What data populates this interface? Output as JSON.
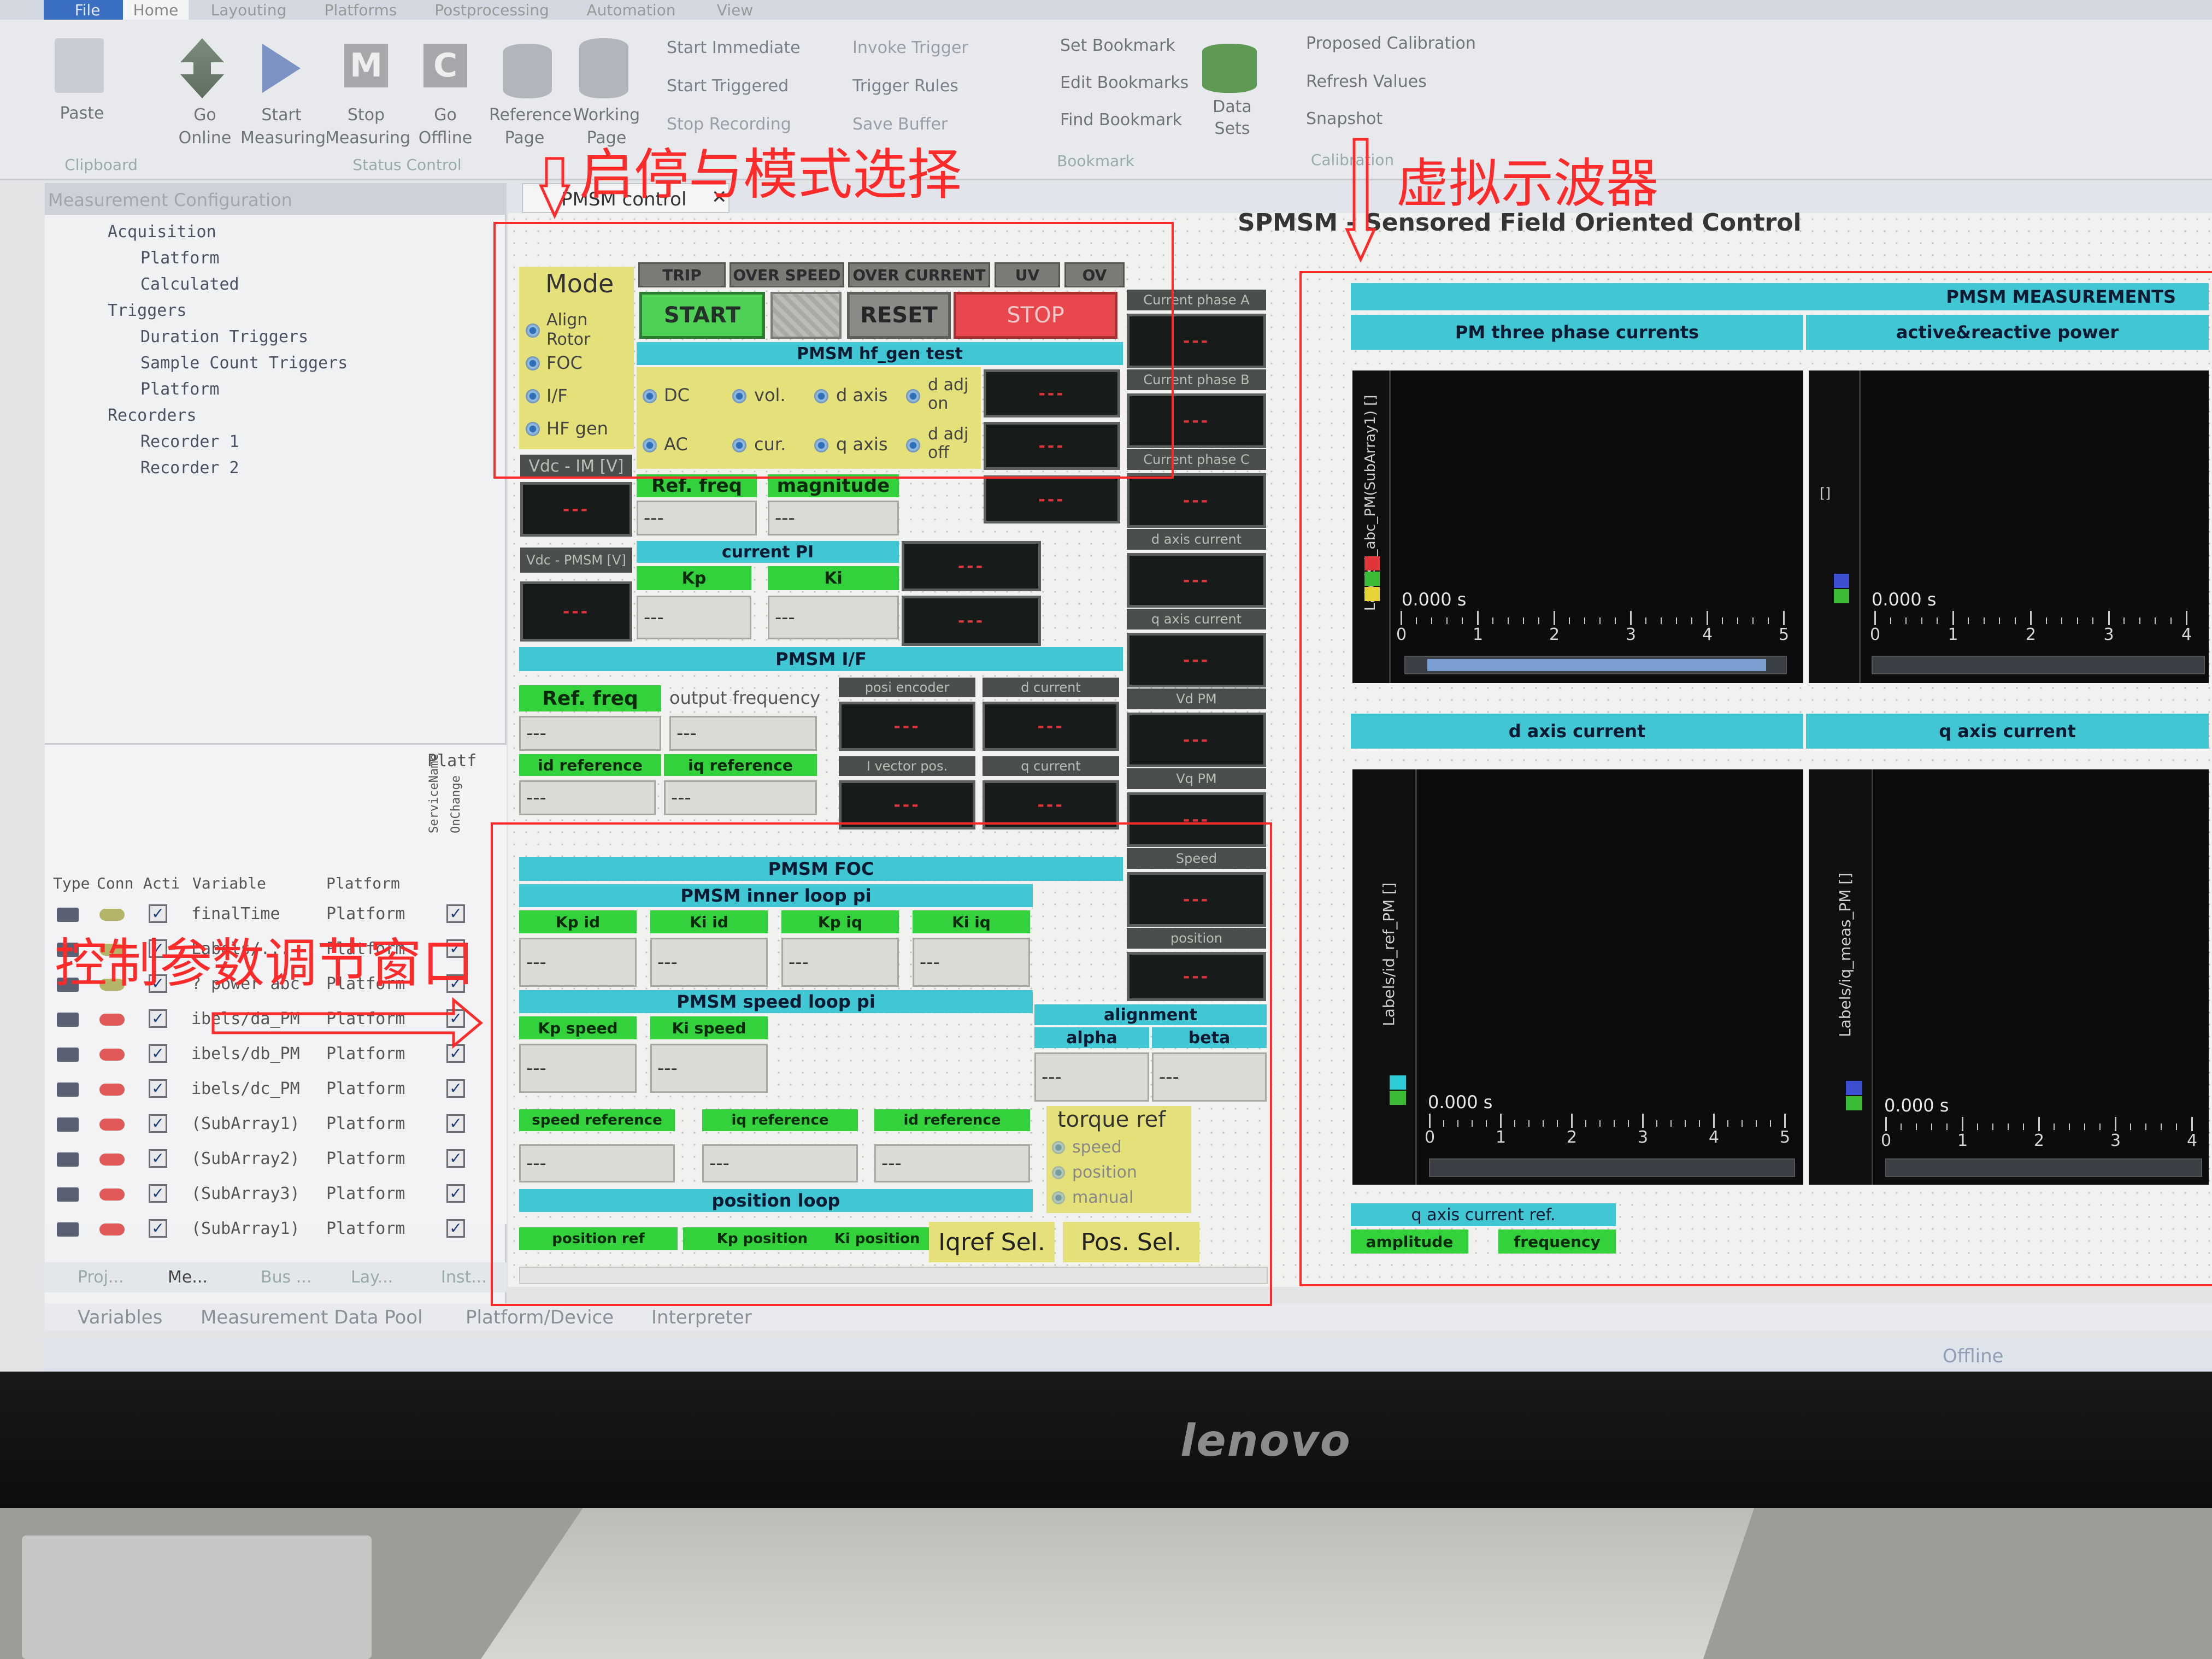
{
  "ribbon": {
    "tabs": [
      "File",
      "Home",
      "Layouting",
      "Platforms",
      "Postprocessing",
      "Automation",
      "View"
    ],
    "clipboard": {
      "paste": "Paste",
      "group": "Clipboard"
    },
    "status_control": {
      "go_online": "Go Online",
      "start_measuring": "Start Measuring",
      "stop_measuring": "Stop Measuring",
      "go_offline": "Go Offline",
      "reference_page": "Reference Page",
      "working_page": "Working Page",
      "group": "Status Control"
    },
    "recording": {
      "start_immediate": "Start Immediate",
      "invoke_trigger": "Invoke Trigger",
      "start_triggered": "Start Triggered",
      "trigger_rules": "Trigger Rules",
      "stop_recording": "Stop Recording",
      "save_buffer": "Save Buffer"
    },
    "bookmark": {
      "set": "Set Bookmark",
      "edit": "Edit Bookmarks",
      "find": "Find Bookmark",
      "group": "Bookmark"
    },
    "data_sets": "Data Sets",
    "calibration": {
      "proposed": "Proposed Calibration",
      "refresh": "Refresh Values",
      "snapshot": "Snapshot",
      "group": "Calibration"
    }
  },
  "left_panel": {
    "title": "Measurement Configuration",
    "tree": [
      "Acquisition",
      "Platform",
      "Calculated",
      "Triggers",
      "Duration Triggers",
      "Sample Count Triggers",
      "Platform",
      "Recorders",
      "Recorder 1",
      "Recorder 2"
    ],
    "grid_header": {
      "type": "Type",
      "conn": "Conn",
      "act": "Acti",
      "variable": "Variable",
      "platform": "Platform",
      "plat_col": "Platf",
      "service": "ServiceName",
      "onchange": "OnChange"
    },
    "rows": [
      {
        "variable": "finalTime",
        "platform": "Platform"
      },
      {
        "variable": "Labels/...",
        "platform": "Platform"
      },
      {
        "variable": "? power abc",
        "platform": "Platform"
      },
      {
        "variable": "ibels/da_PM",
        "platform": "Platform"
      },
      {
        "variable": "ibels/db_PM",
        "platform": "Platform"
      },
      {
        "variable": "ibels/dc_PM",
        "platform": "Platform"
      },
      {
        "variable": "(SubArray1)",
        "platform": "Platform"
      },
      {
        "variable": "(SubArray2)",
        "platform": "Platform"
      },
      {
        "variable": "(SubArray3)",
        "platform": "Platform"
      },
      {
        "variable": "(SubArray1)",
        "platform": "Platform"
      }
    ],
    "bottom_tabs": [
      "Proj...",
      "Me...",
      "Bus ...",
      "Lay...",
      "Inst..."
    ]
  },
  "bottom_tabs": [
    "Variables",
    "Measurement Data Pool",
    "Platform/Device",
    "Interpreter"
  ],
  "status_text": "Offline",
  "monitor_brand": "lenovo",
  "doc_tab": "PMSM control",
  "layout_title": "SPMSM - Sensored Field Oriented Control",
  "mode": {
    "title": "Mode",
    "options": [
      "Align Rotor",
      "FOC",
      "I/F",
      "HF gen"
    ]
  },
  "status_indicators": [
    "TRIP",
    "OVER SPEED",
    "OVER CURRENT",
    "UV",
    "OV"
  ],
  "buttons": {
    "start": "START",
    "reset": "RESET",
    "stop": "STOP"
  },
  "hf_gen": {
    "title": "PMSM hf_gen test",
    "options": [
      "DC",
      "AC",
      "vol.",
      "cur.",
      "d axis",
      "q axis",
      "d adj on",
      "d adj off"
    ]
  },
  "vdc_im": "Vdc - IM [V]",
  "vdc_pmsm": "Vdc - PMSM [V]",
  "ref_freq": "Ref. freq",
  "magnitude": "magnitude",
  "current_pi": {
    "title": "current PI",
    "kp": "Kp",
    "ki": "Ki"
  },
  "pmsm_if": {
    "title": "PMSM I/F",
    "ref_freq": "Ref. freq",
    "output_frequency": "output frequency",
    "id_reference": "id reference",
    "iq_reference": "iq reference"
  },
  "encoder_labels": {
    "posi_encoder": "posi encoder",
    "d_current": "d current",
    "i_vector_pos": "I vector pos.",
    "q_current": "q current"
  },
  "right_displays": [
    "Current phase A",
    "Current phase B",
    "Current phase C",
    "d axis current",
    "q axis current",
    "Vd PM",
    "Vq PM",
    "Speed",
    "position"
  ],
  "display_value": "---",
  "input_value": "---",
  "foc": {
    "title": "PMSM FOC",
    "inner": {
      "title": "PMSM inner loop pi",
      "kp_id": "Kp id",
      "ki_id": "Ki id",
      "kp_iq": "Kp iq",
      "ki_iq": "Ki iq"
    },
    "speed": {
      "title": "PMSM speed loop pi",
      "kp_speed": "Kp speed",
      "ki_speed": "Ki speed"
    },
    "alignment": {
      "title": "alignment",
      "alpha": "alpha",
      "beta": "beta"
    },
    "refs": {
      "speed_reference": "speed reference",
      "iq_reference": "iq reference",
      "id_reference": "id reference"
    },
    "torque": {
      "title": "torque ref",
      "options": [
        "speed",
        "position",
        "manual"
      ]
    },
    "position": {
      "title": "position loop",
      "position_ref": "position ref",
      "kp_position": "Kp position",
      "ki_position": "Ki position",
      "iqref_sel": "Iqref Sel.",
      "pos_sel": "Pos. Sel."
    }
  },
  "scopes": {
    "title": "PMSM MEASUREMENTS",
    "panels": [
      {
        "title": "PM three phase currents",
        "ylabel": "Labels/i_abc_PM(SubArray1) []",
        "time": "0.000 s",
        "ticks": [
          "0",
          "1",
          "2",
          "3",
          "4",
          "5"
        ]
      },
      {
        "title": "active&reactive power",
        "ylabel": "[]",
        "time": "0.000 s",
        "ticks": [
          "0",
          "1",
          "2",
          "3",
          "4"
        ]
      },
      {
        "title": "d axis current",
        "ylabel": "Labels/id_ref_PM []",
        "time": "0.000 s",
        "ticks": [
          "0",
          "1",
          "2",
          "3",
          "4",
          "5"
        ]
      },
      {
        "title": "q axis current",
        "ylabel": "Labels/iq_meas_PM []",
        "time": "0.000 s",
        "ticks": [
          "0",
          "1",
          "2",
          "3",
          "4"
        ]
      }
    ],
    "q_ref": {
      "title": "q axis current ref.",
      "amplitude": "amplitude",
      "frequency": "frequency"
    }
  },
  "annotations": {
    "start_mode": "启停与模式选择",
    "oscilloscope": "虚拟示波器",
    "params": "控制参数调节窗口"
  },
  "colors": {
    "cyan": "#41c6d4",
    "green": "#33d13c",
    "yellow": "#e4e07a",
    "red_button": "#e8474d",
    "annotation": "#ff2a2a"
  }
}
